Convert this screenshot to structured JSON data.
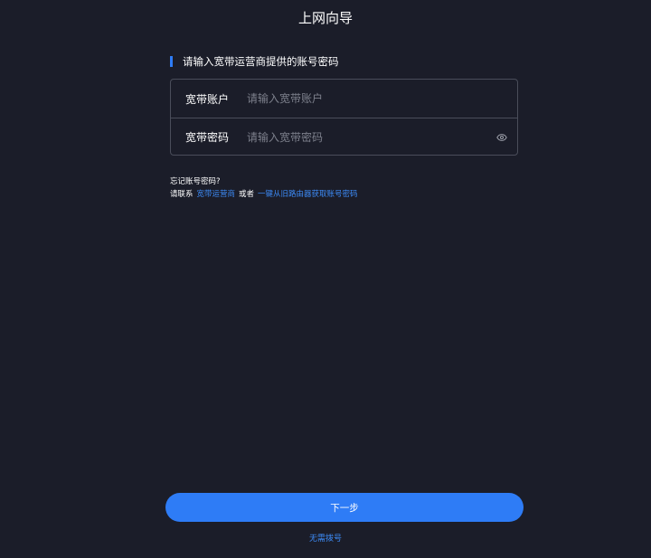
{
  "page": {
    "title": "上网向导"
  },
  "section": {
    "title": "请输入宽带运营商提供的账号密码"
  },
  "form": {
    "account_label": "宽带账户",
    "account_placeholder": "请输入宽带账户",
    "account_value": "",
    "password_label": "宽带密码",
    "password_placeholder": "请输入宽带密码",
    "password_value": ""
  },
  "help": {
    "question": "忘记账号密码?",
    "contact_prefix": "请联系",
    "isp_link": "宽带运营商",
    "or_text": "或者",
    "router_link": "一键从旧路由器获取账号密码"
  },
  "actions": {
    "next_label": "下一步",
    "no_dial_label": "无需拨号"
  },
  "colors": {
    "background": "#1b1d29",
    "accent": "#2e7cf6",
    "link": "#3d8bf7",
    "border": "#4a4d5a",
    "placeholder": "#7d808c"
  },
  "icons": {
    "password_toggle": "eye-icon"
  }
}
